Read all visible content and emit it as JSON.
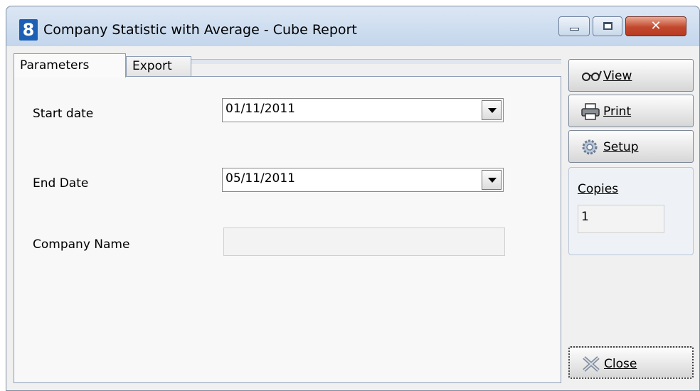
{
  "window": {
    "title": "Company Statistic with Average - Cube Report",
    "app_icon_glyph": "8"
  },
  "tabs": [
    {
      "label": "Parameters",
      "active": true
    },
    {
      "label": "Export",
      "active": false
    }
  ],
  "form": {
    "start_date_label": "Start date",
    "start_date_value": "01/11/2011",
    "end_date_label": "End Date",
    "end_date_value": "05/11/2011",
    "company_name_label": "Company Name",
    "company_name_value": ""
  },
  "side": {
    "view_label": "View",
    "print_label": "Print",
    "setup_label": "Setup",
    "copies_label": "Copies",
    "copies_value": "1",
    "close_label": "Close"
  },
  "icons": {
    "view": "glasses-icon",
    "print": "printer-icon",
    "setup": "gear-icon",
    "close": "close-cross-icon"
  },
  "colors": {
    "titlebar": "#c7d9ee",
    "close_button": "#c2482d",
    "app_icon": "#1d5fb4"
  }
}
